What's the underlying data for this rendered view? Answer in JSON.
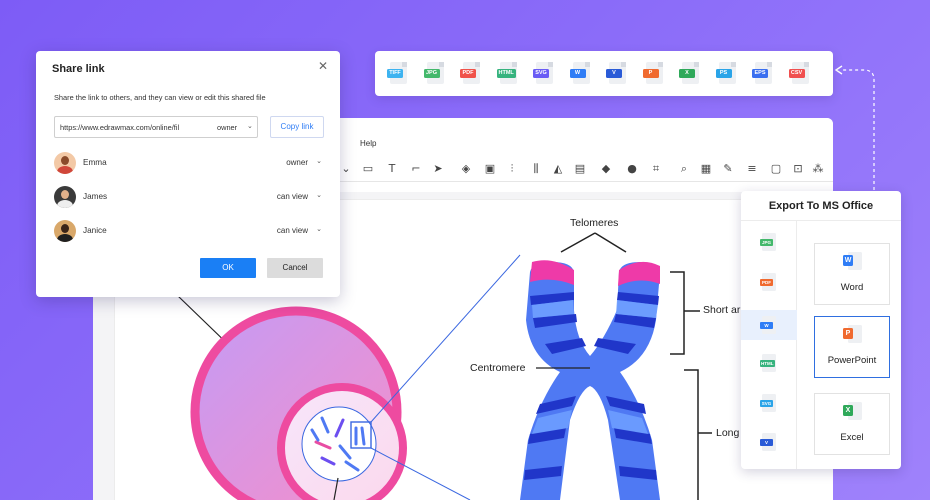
{
  "editor": {
    "menu_help": "Help"
  },
  "formats": [
    {
      "label": "TIFF",
      "color": "#3db3f0"
    },
    {
      "label": "JPG",
      "color": "#43b86b"
    },
    {
      "label": "PDF",
      "color": "#f0524a"
    },
    {
      "label": "HTML",
      "color": "#36b37e"
    },
    {
      "label": "SVG",
      "color": "#6a5cf5"
    },
    {
      "label": "W",
      "color": "#2f7df6"
    },
    {
      "label": "V",
      "color": "#2a5bd7"
    },
    {
      "label": "P",
      "color": "#f06a2f"
    },
    {
      "label": "X",
      "color": "#2fa95a"
    },
    {
      "label": "PS",
      "color": "#2aa4e8"
    },
    {
      "label": "EPS",
      "color": "#3a6ff0"
    },
    {
      "label": "CSV",
      "color": "#f04f4f"
    }
  ],
  "share": {
    "title": "Share link",
    "description": "Share the link to others, and they can view or edit this shared file",
    "url": "https://www.edrawmax.com/online/fil",
    "url_role": "owner",
    "copy_label": "Copy link",
    "users": [
      {
        "name": "Emma",
        "role": "owner"
      },
      {
        "name": "James",
        "role": "can view"
      },
      {
        "name": "Janice",
        "role": "can view"
      }
    ],
    "ok_label": "OK",
    "cancel_label": "Cancel"
  },
  "export": {
    "title": "Export To MS Office",
    "side_formats": [
      {
        "label": "JPG",
        "color": "#43b86b"
      },
      {
        "label": "PDF",
        "color": "#f06a2f"
      },
      {
        "label": "W",
        "color": "#2f7df6"
      },
      {
        "label": "HTML",
        "color": "#36b37e"
      },
      {
        "label": "SVG",
        "color": "#2aa4e8"
      },
      {
        "label": "V",
        "color": "#2a5bd7"
      }
    ],
    "options": [
      {
        "label": "Word",
        "tag": "W",
        "color": "#2f7df6"
      },
      {
        "label": "PowerPoint",
        "tag": "P",
        "color": "#f06a2f"
      },
      {
        "label": "Excel",
        "tag": "X",
        "color": "#2fa95a"
      }
    ]
  },
  "diagram": {
    "telomeres": "Telomeres",
    "centromere": "Centromere",
    "short_arm": "Short ar",
    "long_arm": "Long"
  },
  "colors": {
    "background": "#8066f7",
    "accent": "#1a7ff5",
    "cell_pink": "#f0519f",
    "chromosome_blue": "#4f79f3"
  }
}
